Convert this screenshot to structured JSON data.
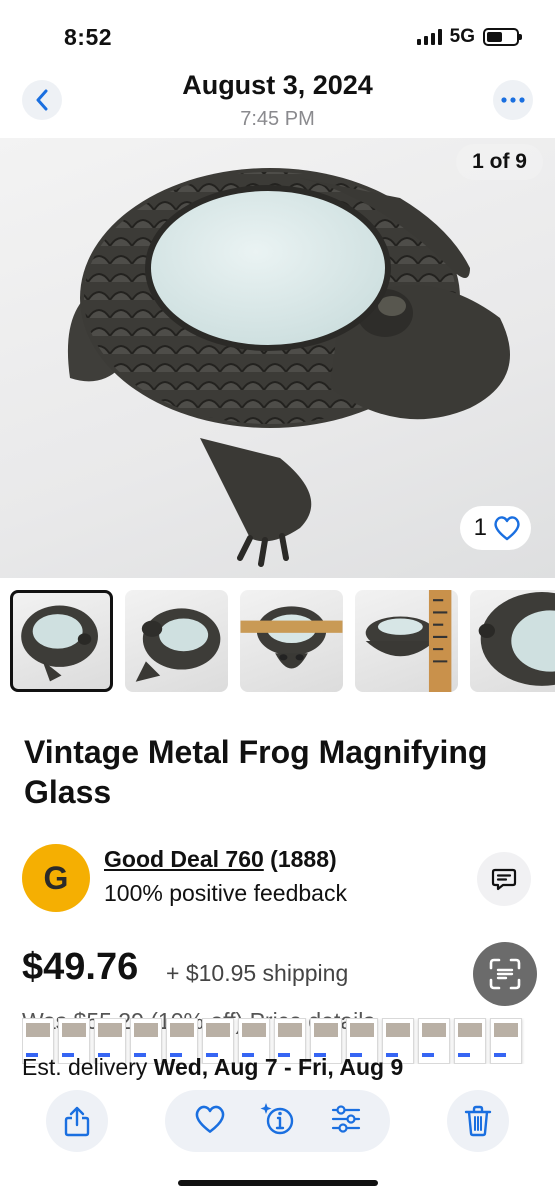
{
  "status_bar": {
    "time": "8:52",
    "network": "5G",
    "battery_percent": 55
  },
  "header": {
    "date": "August 3, 2024",
    "time": "7:45 PM"
  },
  "gallery": {
    "counter": "1 of 9",
    "like_count": "1",
    "thumbnail_count": 5,
    "selected_index": 0
  },
  "listing": {
    "title": "Vintage Metal Frog Magnifying Glass",
    "seller_initial": "G",
    "seller_name": "Good Deal 760",
    "seller_score": "(1888)",
    "seller_feedback": "100% positive feedback",
    "price": "$49.76",
    "shipping": "+ $10.95 shipping",
    "was_price": "Was $55.29 (10% off)  Price details",
    "est_label": "Est. delivery",
    "est_dates": "Wed, Aug 7 - Fri, Aug 9"
  },
  "icons": {
    "back": "chevron-left-icon",
    "more": "ellipsis-icon",
    "like": "heart-icon",
    "message": "message-icon",
    "scan": "text-scan-icon",
    "share": "share-icon",
    "favorite": "heart-icon",
    "info": "info-sparkle-icon",
    "adjust": "sliders-icon",
    "delete": "trash-icon"
  },
  "colors": {
    "accent": "#1a6fe0",
    "seller_avatar": "#f5af02",
    "text": "#111111"
  }
}
